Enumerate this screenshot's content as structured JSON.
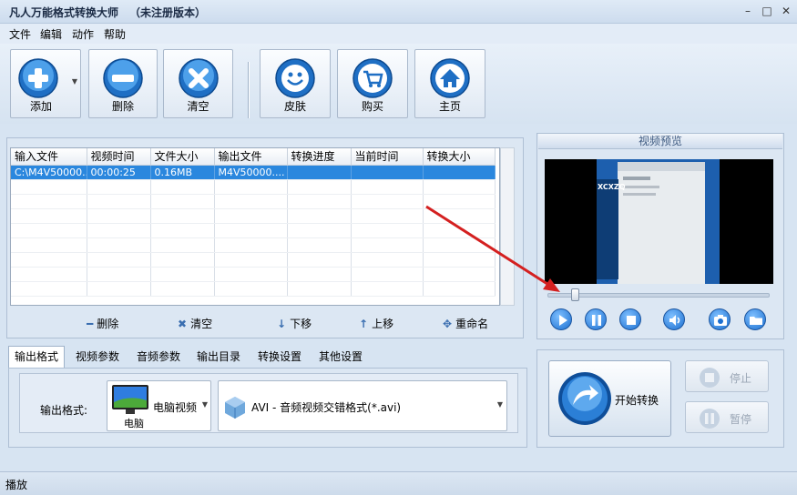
{
  "window": {
    "title": "凡人万能格式转换大师",
    "subtitle": "（未注册版本）",
    "controls": [
      "–",
      "□",
      "✕"
    ]
  },
  "menu": [
    "文件",
    "编辑",
    "动作",
    "帮助"
  ],
  "toolbar": {
    "add": "添加",
    "delete": "删除",
    "clear": "清空",
    "skin": "皮肤",
    "buy": "购买",
    "home": "主页"
  },
  "file_list": {
    "columns": [
      "输入文件",
      "视频时间",
      "文件大小",
      "输出文件",
      "转换进度",
      "当前时间",
      "转换大小"
    ],
    "rows": [
      [
        "C:\\M4V50000...",
        "00:00:25",
        "0.16MB",
        "M4V50000....",
        "",
        "",
        ""
      ]
    ],
    "actions": {
      "delete": "删除",
      "clear": "清空",
      "move_down": "下移",
      "move_up": "上移",
      "rename": "重命名"
    }
  },
  "preview": {
    "title": "视频预览",
    "video_text": "XCXZQ"
  },
  "tabs": [
    "输出格式",
    "视频参数",
    "音频参数",
    "输出目录",
    "转换设置",
    "其他设置"
  ],
  "output": {
    "label": "输出格式:",
    "category": "电脑视频",
    "category_icon_caption": "电脑",
    "format": "AVI - 音频视频交错格式(*.avi)"
  },
  "convert": {
    "start": "开始转换",
    "stop": "停止",
    "pause": "暂停"
  },
  "status": "播放",
  "colors": {
    "accent_blue": "#2a87de",
    "selection": "#2a87de",
    "annotation_red": "#d42020"
  }
}
